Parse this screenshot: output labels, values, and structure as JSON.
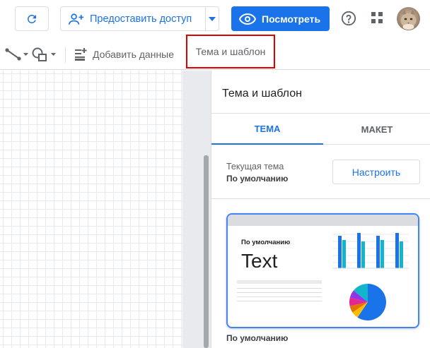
{
  "toolbar": {
    "refresh_icon": "refresh-icon",
    "share_label": "Предоставить доступ",
    "share_icon": "add-person-icon",
    "view_label": "Посмотреть",
    "view_icon": "eye-icon",
    "help_icon": "help-circle-icon",
    "apps_icon": "apps-grid-icon",
    "accent_color": "#1a73e8"
  },
  "tools": {
    "line_icon": "line-tool-icon",
    "shape_icon": "shape-tool-icon",
    "add_data_label": "Добавить данные",
    "add_data_icon": "add-data-icon",
    "theme_label": "Тема и шаблон",
    "highlight_color": "#e00000"
  },
  "panel": {
    "title": "Тема и шаблон",
    "tabs": [
      {
        "label": "ТЕМА",
        "active": true
      },
      {
        "label": "МАКЕТ",
        "active": false
      }
    ],
    "current_theme_label": "Текущая тема",
    "current_theme_value": "По умолчанию",
    "customize_label": "Настроить",
    "card": {
      "name": "По умолчанию",
      "sample_text": "Text"
    },
    "card_caption": "По умолчанию"
  }
}
